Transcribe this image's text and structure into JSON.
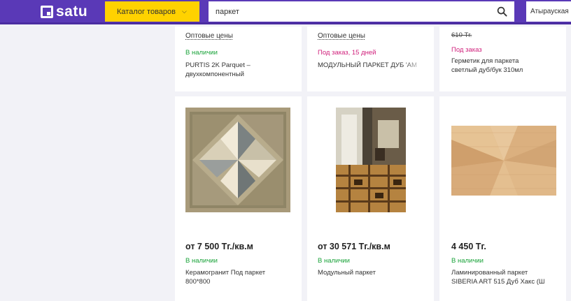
{
  "header": {
    "logo_text": "satu",
    "catalog_label": "Каталог товаров",
    "search_value": "паркет",
    "region_label": "Атырауская",
    "colors": {
      "header_bg": "#5a39b7",
      "catalog_bg": "#ffd200"
    }
  },
  "row1": [
    {
      "wholesale": "Оптовые цены",
      "availability": "В наличии",
      "availability_status": "in",
      "title_lines": [
        "PURTIS 2K Parquet –",
        "двухкомпонентный"
      ]
    },
    {
      "wholesale": "Оптовые цены",
      "availability": "Под заказ, 15 дней",
      "availability_status": "order",
      "title_lines": [
        "МОДУЛЬНЫЙ ПАРКЕТ ДУБ 'АМ"
      ]
    },
    {
      "old_price": "610 Тг.",
      "availability": "Под заказ",
      "availability_status": "order",
      "title_lines": [
        "Герметик для паркета",
        "светлый дуб/бук 310мл"
      ]
    }
  ],
  "row2": [
    {
      "price": "от 7 500 Тг./кв.м",
      "availability": "В наличии",
      "availability_status": "in",
      "title_lines": [
        "Керамогранит Под паркет",
        "800*800"
      ]
    },
    {
      "price": "от 30 571 Тг./кв.м",
      "availability": "В наличии",
      "availability_status": "in",
      "title_lines": [
        "Модульный паркет"
      ]
    },
    {
      "price": "4 450 Тг.",
      "availability": "В наличии",
      "availability_status": "in",
      "title_lines": [
        "Ламинированный паркет",
        "SIBERIA ART 515 Дуб Хакс (Ш"
      ]
    }
  ]
}
